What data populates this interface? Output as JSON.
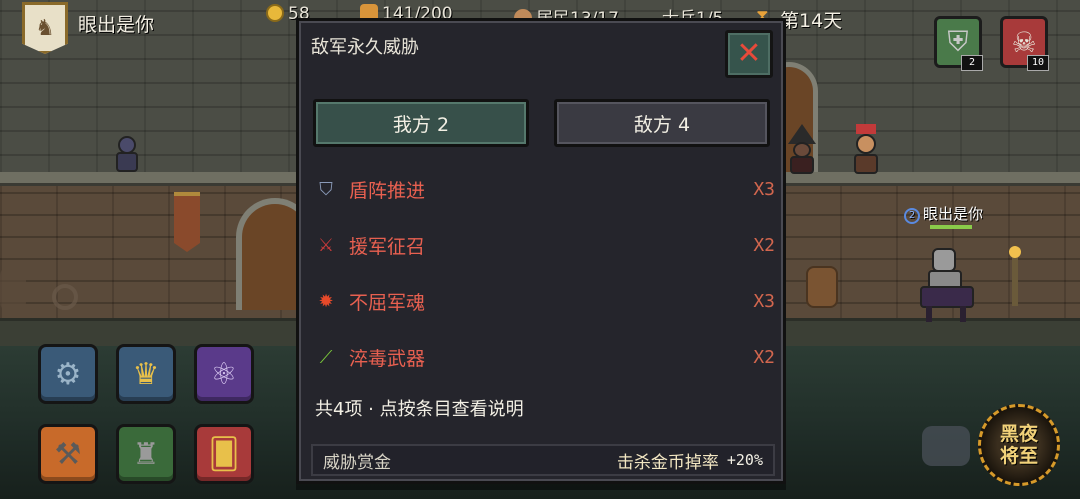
{
  "hud": {
    "player_name": "眼出是你",
    "gold": "58",
    "food": "141/200",
    "population": "居民13/17",
    "soldiers": "士兵1/5",
    "day": "第14天"
  },
  "corner_icons": {
    "knight_count": "2",
    "skull_count": "10"
  },
  "leader": {
    "number": "2",
    "name": "眼出是你"
  },
  "night_button": {
    "line1": "黑夜",
    "line2": "将至"
  },
  "menu_buttons": [
    {
      "icon": "gear-icon"
    },
    {
      "icon": "crown-icon"
    },
    {
      "icon": "skill-tree-icon"
    },
    {
      "icon": "anvil-hammer-icon"
    },
    {
      "icon": "tower-icon"
    },
    {
      "icon": "cards-icon"
    }
  ],
  "modal": {
    "title": "敌军永久威胁",
    "tabs": {
      "ally": "我方 2",
      "enemy": "敌方 4"
    },
    "threats": [
      {
        "name": "盾阵推进",
        "count": "X3",
        "icon": "shield-icon",
        "color": "#e86050"
      },
      {
        "name": "援军征召",
        "count": "X2",
        "icon": "crossed-swords-icon",
        "color": "#e86050"
      },
      {
        "name": "不屈军魂",
        "count": "X3",
        "icon": "flame-spirit-icon",
        "color": "#e86050"
      },
      {
        "name": "淬毒武器",
        "count": "X2",
        "icon": "poison-blade-icon",
        "color": "#e86050"
      }
    ],
    "summary": "共4项 · 点按条目查看说明",
    "bounty": {
      "label": "威胁赏金",
      "effect": "击杀金币掉率",
      "value": "+20%"
    }
  }
}
